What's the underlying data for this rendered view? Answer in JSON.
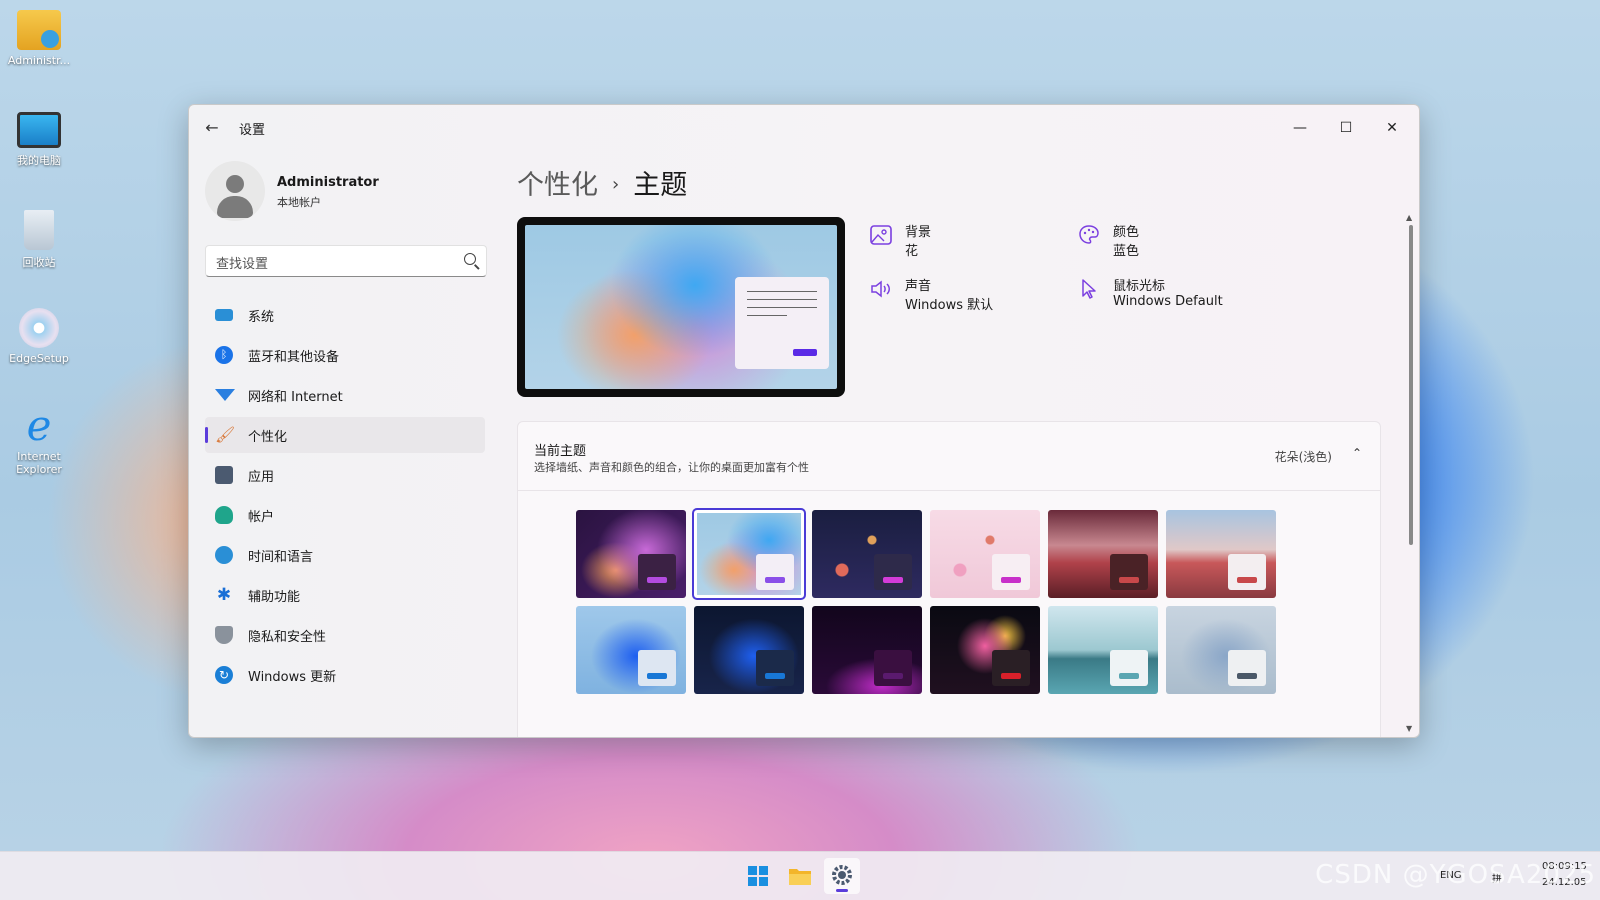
{
  "desktop": {
    "icons": [
      {
        "label": "Administr...",
        "icon": "user-folder-icon"
      },
      {
        "label": "我的电脑",
        "icon": "computer-icon"
      },
      {
        "label": "回收站",
        "icon": "recycle-bin-icon"
      },
      {
        "label": "EdgeSetup",
        "icon": "setup-disc-icon"
      },
      {
        "label": "Internet Explorer",
        "icon": "internet-explorer-icon"
      }
    ]
  },
  "window": {
    "title": "设置",
    "controls": {
      "minimize": "—",
      "maximize": "☐",
      "close": "✕"
    }
  },
  "profile": {
    "name": "Administrator",
    "account_type": "本地帐户"
  },
  "search": {
    "placeholder": "查找设置"
  },
  "nav": {
    "items": [
      {
        "label": "系统",
        "icon": "system-icon",
        "color": "#2a8fd6"
      },
      {
        "label": "蓝牙和其他设备",
        "icon": "bluetooth-icon",
        "color": "#1a73e8"
      },
      {
        "label": "网络和 Internet",
        "icon": "wifi-icon",
        "color": "#2a7fe0"
      },
      {
        "label": "个性化",
        "icon": "brush-icon",
        "color": "#d97a3c",
        "active": true
      },
      {
        "label": "应用",
        "icon": "apps-icon",
        "color": "#4b5a70"
      },
      {
        "label": "帐户",
        "icon": "account-icon",
        "color": "#1fa58b"
      },
      {
        "label": "时间和语言",
        "icon": "globe-clock-icon",
        "color": "#2a8fd6"
      },
      {
        "label": "辅助功能",
        "icon": "accessibility-icon",
        "color": "#1a6fd6"
      },
      {
        "label": "隐私和安全性",
        "icon": "shield-icon",
        "color": "#6b7280"
      },
      {
        "label": "Windows 更新",
        "icon": "update-icon",
        "color": "#1a7fd6"
      }
    ]
  },
  "main": {
    "breadcrumb": {
      "parent": "个性化",
      "separator": "›",
      "current": "主题"
    },
    "properties": [
      {
        "title": "背景",
        "value": "花",
        "icon": "image-icon"
      },
      {
        "title": "颜色",
        "value": "蓝色",
        "icon": "palette-icon"
      },
      {
        "title": "声音",
        "value": "Windows 默认",
        "icon": "speaker-icon"
      },
      {
        "title": "鼠标光标",
        "value": "Windows Default",
        "icon": "cursor-icon"
      }
    ],
    "current_theme": {
      "title": "当前主题",
      "description": "选择墙纸、声音和颜色的组合，让你的桌面更加富有个性",
      "value": "花朵(浅色)",
      "chevron": "⌃"
    },
    "themes": [
      {
        "name": "theme-1",
        "accent": "#b34be0",
        "chip_bg": "#3b2144"
      },
      {
        "name": "theme-2",
        "accent": "#8a4ee8",
        "chip_bg": "#f3eef6",
        "selected": true
      },
      {
        "name": "theme-3",
        "accent": "#d33cd8",
        "chip_bg": "#2e2a4a"
      },
      {
        "name": "theme-4",
        "accent": "#c82fc9",
        "chip_bg": "#f7eef3"
      },
      {
        "name": "theme-5",
        "accent": "#c8484a",
        "chip_bg": "#4a2226"
      },
      {
        "name": "theme-6",
        "accent": "#c8484a",
        "chip_bg": "#f3eef0"
      },
      {
        "name": "theme-7",
        "accent": "#1877d6",
        "chip_bg": "#dde6f2"
      },
      {
        "name": "theme-8",
        "accent": "#1877d6",
        "chip_bg": "#1b2a4a"
      },
      {
        "name": "theme-9",
        "accent": "#5a1a6e",
        "chip_bg": "#3a0f40"
      },
      {
        "name": "theme-10",
        "accent": "#d8202a",
        "chip_bg": "#2a1f25"
      },
      {
        "name": "theme-11",
        "accent": "#5aa6b2",
        "chip_bg": "#eef3f5"
      },
      {
        "name": "theme-12",
        "accent": "#4a5868",
        "chip_bg": "#eef0f2"
      }
    ]
  },
  "taskbar": {
    "apps": [
      {
        "name": "start",
        "icon": "windows-start-icon"
      },
      {
        "name": "file-explorer",
        "icon": "folder-icon"
      },
      {
        "name": "settings",
        "icon": "gear-icon",
        "active": true
      }
    ],
    "tray": {
      "lang": "ENG",
      "ime": "拼",
      "time": "08:09:15",
      "date": "24.12.05"
    }
  },
  "watermark": "CSDN @YGOSA2025"
}
